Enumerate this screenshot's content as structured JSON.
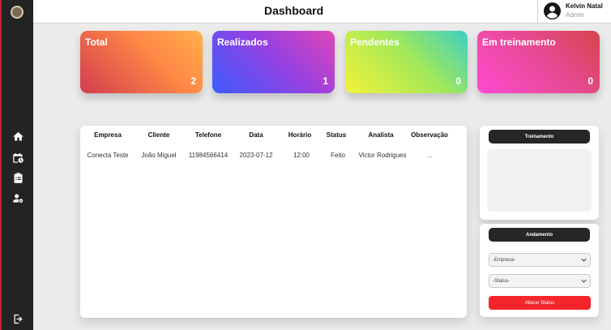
{
  "header": {
    "title": "Dashboard"
  },
  "user": {
    "name": "Kelvin Natal",
    "role": "Admin"
  },
  "sidebar": {
    "icons": [
      "home-icon",
      "calendar-clock-icon",
      "clipboard-icon",
      "user-gear-icon",
      "logout-icon"
    ]
  },
  "cards": [
    {
      "title": "Total",
      "value": "2"
    },
    {
      "title": "Realizados",
      "value": "1"
    },
    {
      "title": "Pendentes",
      "value": "0"
    },
    {
      "title": "Em treinamento",
      "value": "0"
    }
  ],
  "table": {
    "columns": [
      "Empresa",
      "Cliente",
      "Telefone",
      "Data",
      "Horário",
      "Status",
      "Analista",
      "Observação"
    ],
    "rows": [
      [
        "Conecta Teste",
        "João Miguel",
        "11984566414",
        "2023-07-12",
        "12:00",
        "Feito",
        "Victor Rodrigues",
        "..."
      ]
    ]
  },
  "treinamento": {
    "title": "Treinamento"
  },
  "andamento": {
    "title": "Andamento",
    "select_1": "-Empresa-",
    "select_2": "-Status-",
    "button": "Alterar Status"
  },
  "colors": {
    "sidebar": "#232323",
    "accent_red": "#f4262c",
    "dark_header": "#262626"
  }
}
